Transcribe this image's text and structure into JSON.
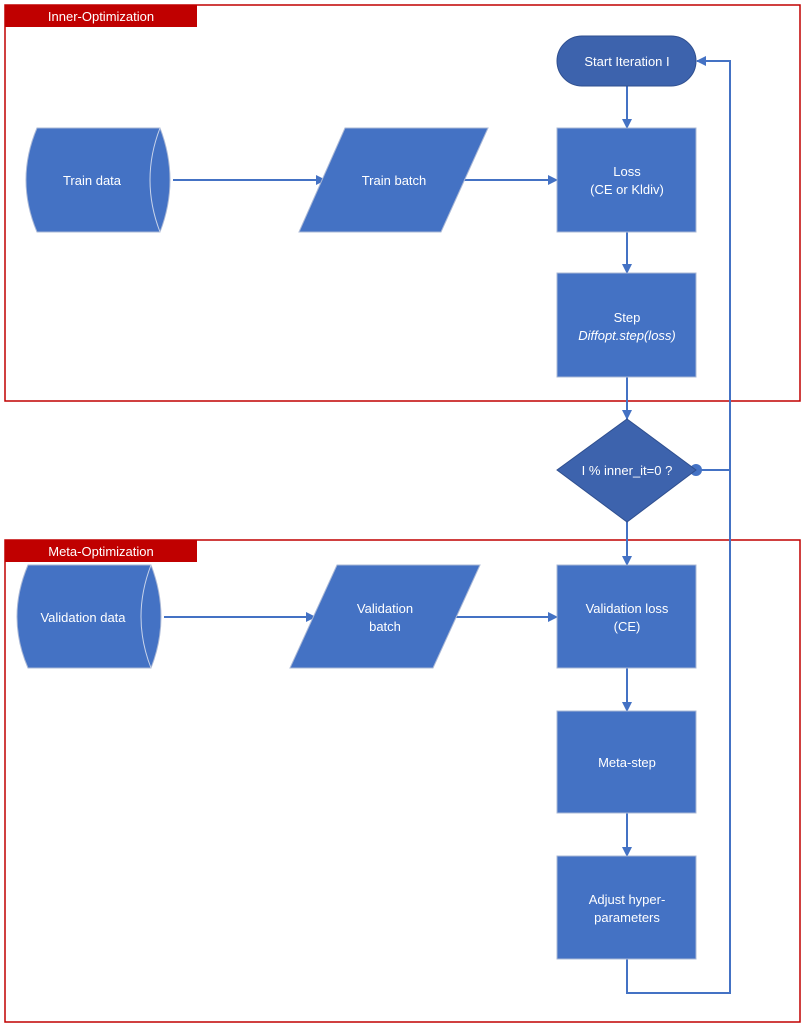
{
  "groups": {
    "inner": {
      "label": "Inner-Optimization"
    },
    "meta": {
      "label": "Meta-Optimization"
    }
  },
  "nodes": {
    "start": {
      "label": "Start Iteration I",
      "shape": "terminator"
    },
    "loss": {
      "line1": "Loss",
      "line2": "(CE or Kldiv)",
      "shape": "process"
    },
    "step": {
      "line1": "Step",
      "line2": "Diffopt.step(loss)",
      "shape": "process"
    },
    "decision": {
      "label": "I % inner_it=0 ?",
      "shape": "decision"
    },
    "train_data": {
      "label": "Train data",
      "shape": "stored-data"
    },
    "train_batch": {
      "label": "Train batch",
      "shape": "data"
    },
    "val_data": {
      "label": "Validation data",
      "shape": "stored-data"
    },
    "val_batch": {
      "line1": "Validation",
      "line2": "batch",
      "shape": "data"
    },
    "val_loss": {
      "line1": "Validation loss",
      "line2": "(CE)",
      "shape": "process"
    },
    "meta_step": {
      "label": "Meta-step",
      "shape": "process"
    },
    "adjust": {
      "line1": "Adjust hyper-",
      "line2": "parameters",
      "shape": "process"
    }
  },
  "colors": {
    "node": "#4472c4",
    "node_dark": "#3d63ad",
    "group_frame": "#c00000",
    "edge": "#4472c4"
  }
}
